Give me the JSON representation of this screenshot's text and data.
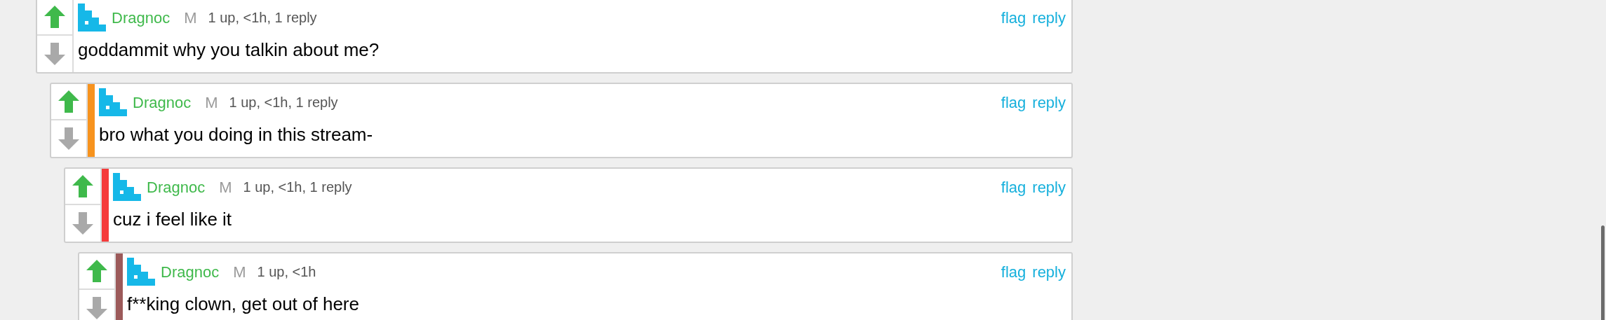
{
  "comments": [
    {
      "author": "Dragnoc",
      "badge": "M",
      "meta": "1 up, <1h, 1 reply",
      "text": "goddammit why you talkin about me?",
      "upvoted": true,
      "actions": [
        "flag",
        "reply"
      ],
      "children": [
        {
          "author": "Dragnoc",
          "badge": "M",
          "meta": "1 up, <1h, 1 reply",
          "text": "bro what you doing in this stream-",
          "upvoted": true,
          "color": "#f7931e",
          "actions": [
            "flag",
            "reply"
          ],
          "children": [
            {
              "author": "Dragnoc",
              "badge": "M",
              "meta": "1 up, <1h, 1 reply",
              "text": "cuz i feel like it",
              "upvoted": true,
              "color": "#f53b3b",
              "actions": [
                "flag",
                "reply"
              ],
              "children": [
                {
                  "author": "Dragnoc",
                  "badge": "M",
                  "meta": "1 up, <1h",
                  "text": "f**king clown, get out of here",
                  "upvoted": true,
                  "color": "#9c5a5a",
                  "actions": [
                    "flag",
                    "reply"
                  ]
                }
              ]
            }
          ]
        }
      ]
    }
  ]
}
